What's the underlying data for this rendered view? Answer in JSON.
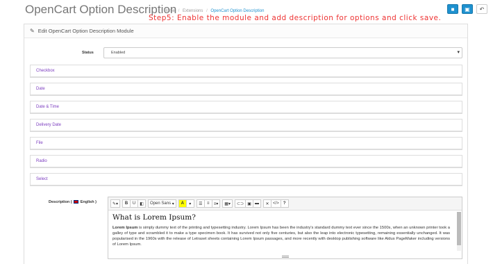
{
  "header": {
    "title": "OpenCart Option Description",
    "breadcrumb": [
      "Home",
      "Extensions",
      "OpenCart Option Description"
    ]
  },
  "step_note": "Step5: Enable the module and add description for options and click save.",
  "panel": {
    "heading": "Edit OpenCart Option Description Module"
  },
  "status": {
    "label": "Status",
    "value": "Enabled"
  },
  "options": [
    "Checkbox",
    "Date",
    "Date & Time",
    "Delivery Date",
    "File",
    "Radio",
    "Select"
  ],
  "description": {
    "label_prefix": "Description (",
    "language": "English",
    "label_suffix": ")"
  },
  "editor": {
    "font_name": "Open Sans",
    "heading": "What is Lorem Ipsum?",
    "lead_bold": "Lorem Ipsum",
    "body": " is simply dummy text of the printing and typesetting industry. Lorem Ipsum has been the industry's standard dummy text ever since the 1500s, when an unknown printer took a galley of type and scrambled it to make a type specimen book. It has survived not only five centuries, but also the leap into electronic typesetting, remaining essentially unchanged. It was popularised in the 1960s with the release of Letraset sheets containing Lorem Ipsum passages, and more recently with desktop publishing software like Aldus PageMaker including versions of Lorem Ipsum."
  },
  "colors": {
    "accent": "#1e91cf",
    "step_note": "#ee3333",
    "option_text": "#7b3bbf"
  }
}
